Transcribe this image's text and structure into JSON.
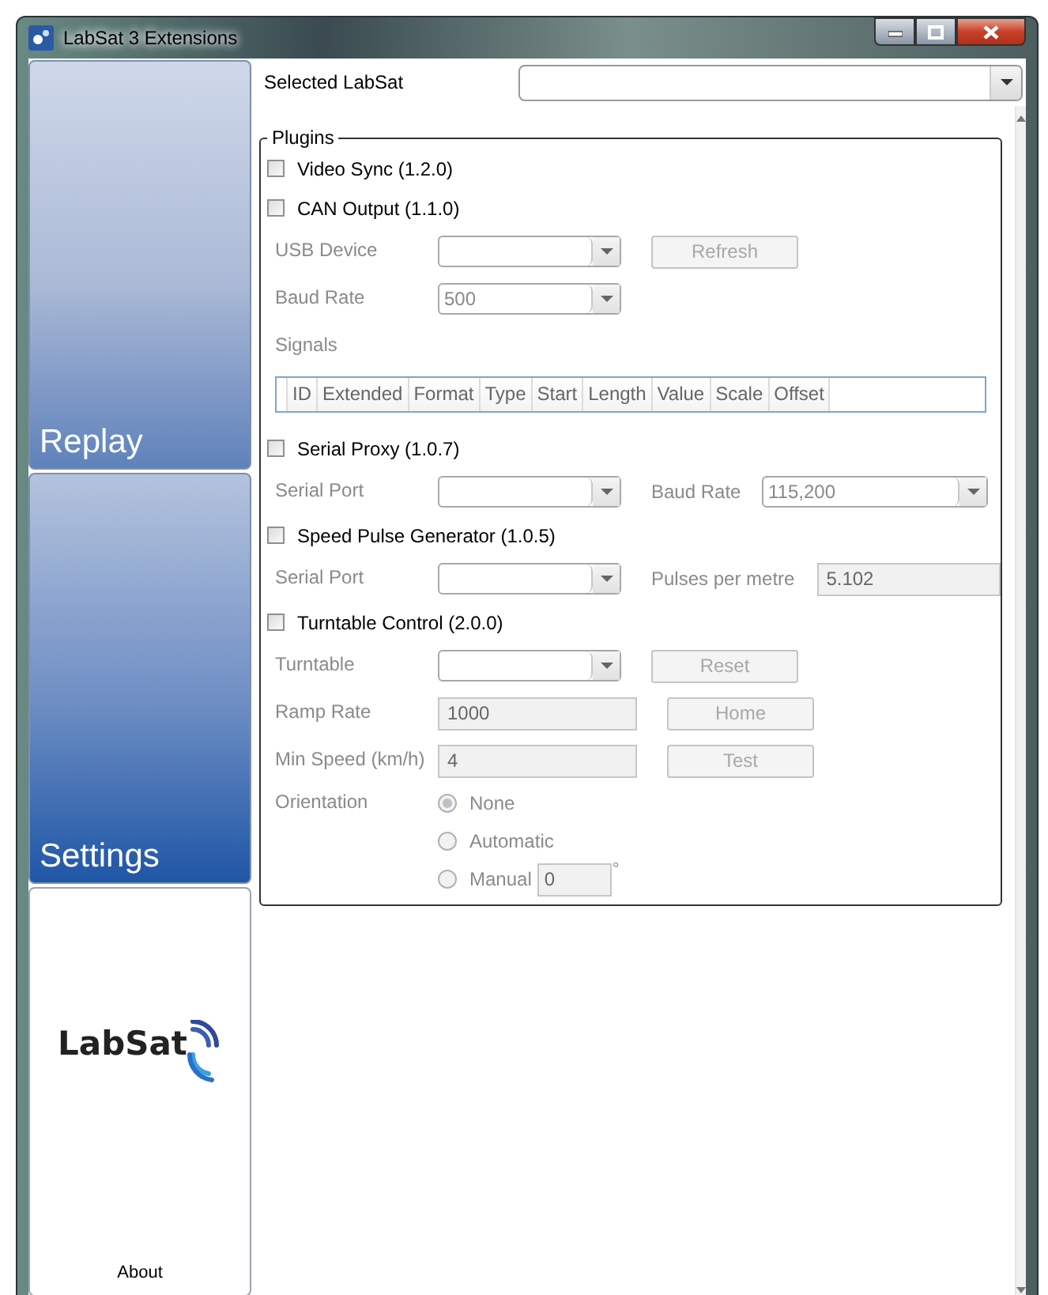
{
  "window": {
    "title": "LabSat 3 Extensions"
  },
  "sidebar": {
    "items": [
      {
        "kind": "tile",
        "label": "Replay",
        "selected": false
      },
      {
        "kind": "tile",
        "label": "Settings",
        "selected": true
      },
      {
        "kind": "logo",
        "logo": "LabSat",
        "label": "About",
        "selected": false
      }
    ]
  },
  "selected_labsat": {
    "label": "Selected LabSat"
  },
  "plugins": {
    "title": "Plugins",
    "items": [
      {
        "name": "Video Sync (1.2.0)",
        "checked": false
      },
      {
        "name": "CAN Output (1.1.0)",
        "checked": false,
        "rows": [
          [
            {
              "kind": "label",
              "text": "USB Device"
            },
            {
              "kind": "combo"
            },
            {
              "kind": "button",
              "text": "Refresh"
            }
          ],
          [
            {
              "kind": "label",
              "text": "Baud Rate"
            },
            {
              "kind": "combo",
              "value": "500"
            }
          ],
          [
            {
              "kind": "label",
              "text": "Signals"
            }
          ],
          [
            {
              "kind": "table",
              "columns": [
                "ID",
                "Extended",
                "Format",
                "Type",
                "Start",
                "Length",
                "Value",
                "Scale",
                "Offset"
              ]
            }
          ]
        ]
      },
      {
        "name": "Serial Proxy (1.0.7)",
        "checked": false,
        "rows": [
          [
            {
              "kind": "label",
              "text": "Serial Port"
            },
            {
              "kind": "combo"
            },
            {
              "kind": "label",
              "text": "Baud Rate"
            },
            {
              "kind": "combo",
              "value": "115,200"
            }
          ]
        ]
      },
      {
        "name": "Speed Pulse Generator (1.0.5)",
        "checked": false,
        "rows": [
          [
            {
              "kind": "label",
              "text": "Serial Port"
            },
            {
              "kind": "combo"
            },
            {
              "kind": "label",
              "text": "Pulses per metre"
            },
            {
              "kind": "field",
              "value": "5.102"
            }
          ]
        ]
      },
      {
        "name": "Turntable Control (2.0.0)",
        "checked": false,
        "rows": [
          [
            {
              "kind": "label",
              "text": "Turntable"
            },
            {
              "kind": "combo"
            },
            {
              "kind": "button",
              "text": "Reset"
            }
          ],
          [
            {
              "kind": "label",
              "text": "Ramp Rate"
            },
            {
              "kind": "field",
              "value": "1000"
            },
            {
              "kind": "button",
              "text": "Home"
            }
          ],
          [
            {
              "kind": "label",
              "text": "Min Speed (km/h)"
            },
            {
              "kind": "field",
              "value": "4"
            },
            {
              "kind": "button",
              "text": "Test"
            }
          ],
          [
            {
              "kind": "label",
              "text": "Orientation"
            },
            {
              "kind": "radio",
              "text": "None",
              "selected": true
            }
          ],
          [
            {
              "kind": "radio",
              "text": "Automatic",
              "selected": false
            }
          ],
          [
            {
              "kind": "radio",
              "text": "Manual",
              "selected": false
            },
            {
              "kind": "field",
              "value": "0"
            },
            {
              "kind": "unit",
              "text": "°"
            }
          ]
        ]
      }
    ]
  }
}
